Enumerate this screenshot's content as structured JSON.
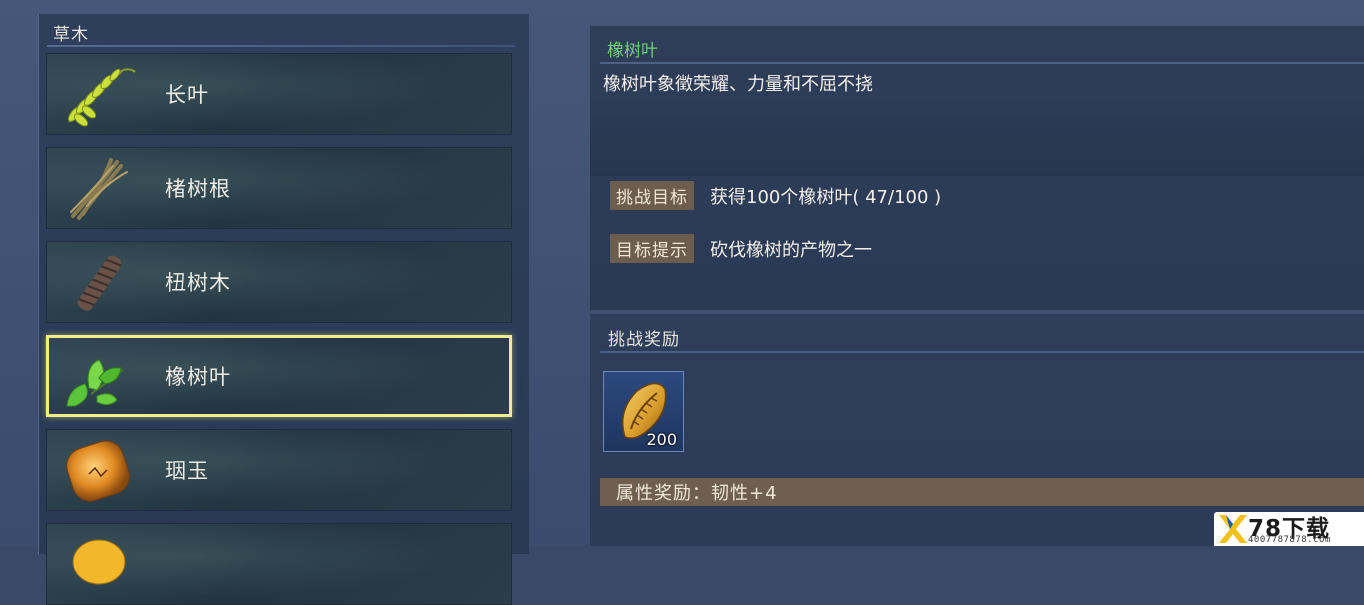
{
  "category": {
    "title": "草木"
  },
  "items": [
    {
      "label": "长叶",
      "icon": "long-leaf-icon",
      "selected": false
    },
    {
      "label": "楮树根",
      "icon": "root-bundle-icon",
      "selected": false
    },
    {
      "label": "杻树木",
      "icon": "bark-log-icon",
      "selected": false
    },
    {
      "label": "橡树叶",
      "icon": "oak-leaf-icon",
      "selected": true
    },
    {
      "label": "珚玉",
      "icon": "amber-jade-icon",
      "selected": false
    },
    {
      "label": "",
      "icon": "gold-stone-icon",
      "selected": false
    }
  ],
  "detail": {
    "title": "橡树叶",
    "description": "橡树叶象徵荣耀、力量和不屈不挠",
    "goal_tag": "挑战目标",
    "goal_text": "获得100个橡树叶( 47/100 )",
    "hint_tag": "目标提示",
    "hint_text": "砍伐橡树的产物之一"
  },
  "reward": {
    "title": "挑战奖励",
    "item_icon": "golden-seed-icon",
    "count": "200",
    "attribute": "属性奖励：韧性+4"
  },
  "watermark": {
    "logo": "X",
    "main": "78下载",
    "sub": "4007787878.com"
  },
  "colors": {
    "selected_border": "#f4ec8c",
    "title_green": "#6fd17a",
    "tag_bg": "#6d5d4c",
    "attr_bar": "#6f5f51"
  }
}
